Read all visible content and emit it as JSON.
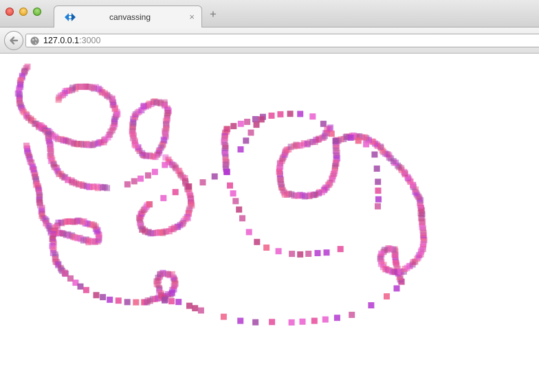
{
  "window": {
    "tab": {
      "title": "canvassing",
      "close_glyph": "×",
      "favicon": "arrows-icon"
    },
    "new_tab_glyph": "+",
    "traffic_lights": [
      "close",
      "minimize",
      "zoom"
    ]
  },
  "toolbar": {
    "url_host": "127.0.0.1",
    "url_port": ":3000",
    "back_icon": "back-arrow-icon",
    "site_icon": "globe-icon"
  },
  "canvas": {
    "description": "drawing canvas with square brush stamps",
    "palette": [
      "#e84a9b",
      "#b43ad0",
      "#ea5ecf",
      "#d05aa0",
      "#c04080",
      "#a34aa8",
      "#f0608a"
    ]
  }
}
